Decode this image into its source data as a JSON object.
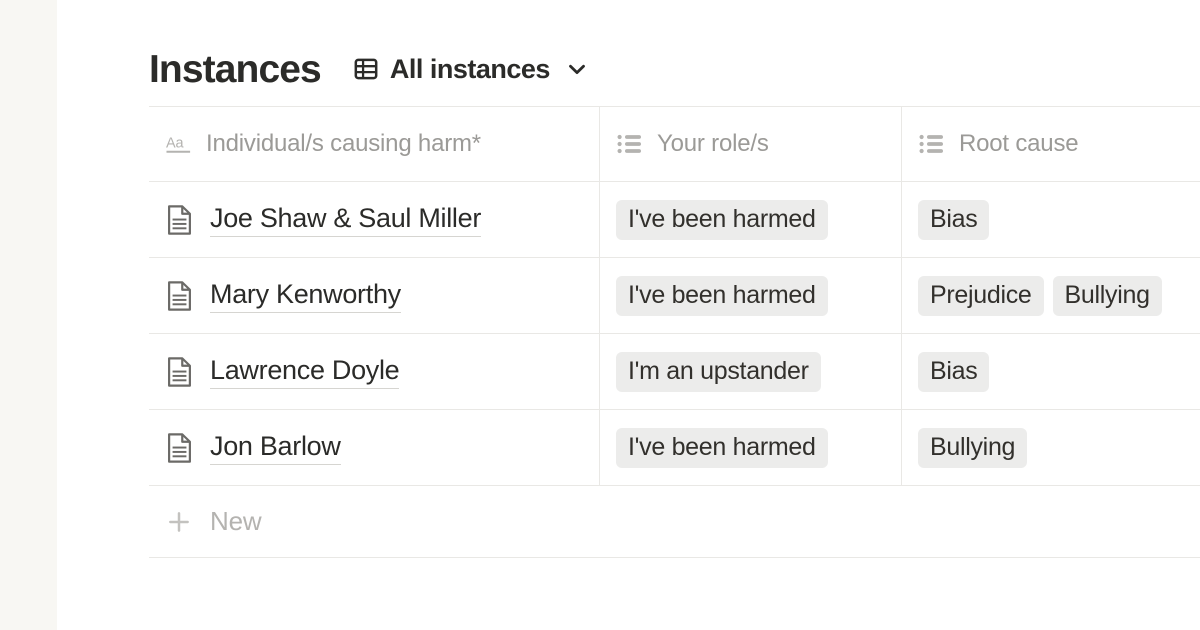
{
  "sidebar": {
    "background_color": "#f8f7f3"
  },
  "header": {
    "title": "Instances",
    "view": {
      "icon": "table-grid-icon",
      "label": "All instances",
      "caret_icon": "chevron-down-icon"
    }
  },
  "table": {
    "columns": [
      {
        "label": "Individual/s causing harm*",
        "icon": "text-aa-icon",
        "type": "title"
      },
      {
        "label": "Your role/s",
        "icon": "multi-select-list-icon",
        "type": "multi-select"
      },
      {
        "label": "Root cause",
        "icon": "multi-select-list-icon",
        "type": "multi-select"
      }
    ],
    "rows": [
      {
        "icon": "page-document-icon",
        "name": "Joe Shaw & Saul Miller",
        "roles": [
          "I've been harmed"
        ],
        "root_causes": [
          "Bias"
        ]
      },
      {
        "icon": "page-document-icon",
        "name": "Mary Kenworthy",
        "roles": [
          "I've been harmed"
        ],
        "root_causes": [
          "Prejudice",
          "Bullying"
        ]
      },
      {
        "icon": "page-document-icon",
        "name": "Lawrence Doyle",
        "roles": [
          "I'm an upstander"
        ],
        "root_causes": [
          "Bias"
        ]
      },
      {
        "icon": "page-document-icon",
        "name": "Jon Barlow",
        "roles": [
          "I've been harmed"
        ],
        "root_causes": [
          "Bullying"
        ]
      }
    ],
    "new_row": {
      "icon": "plus-icon",
      "label": "New"
    }
  },
  "colors": {
    "text_primary": "#2b2b29",
    "text_muted": "#9b9a97",
    "tag_background": "#ececeb",
    "border": "#e9e8e5",
    "sidebar": "#f8f7f3"
  }
}
